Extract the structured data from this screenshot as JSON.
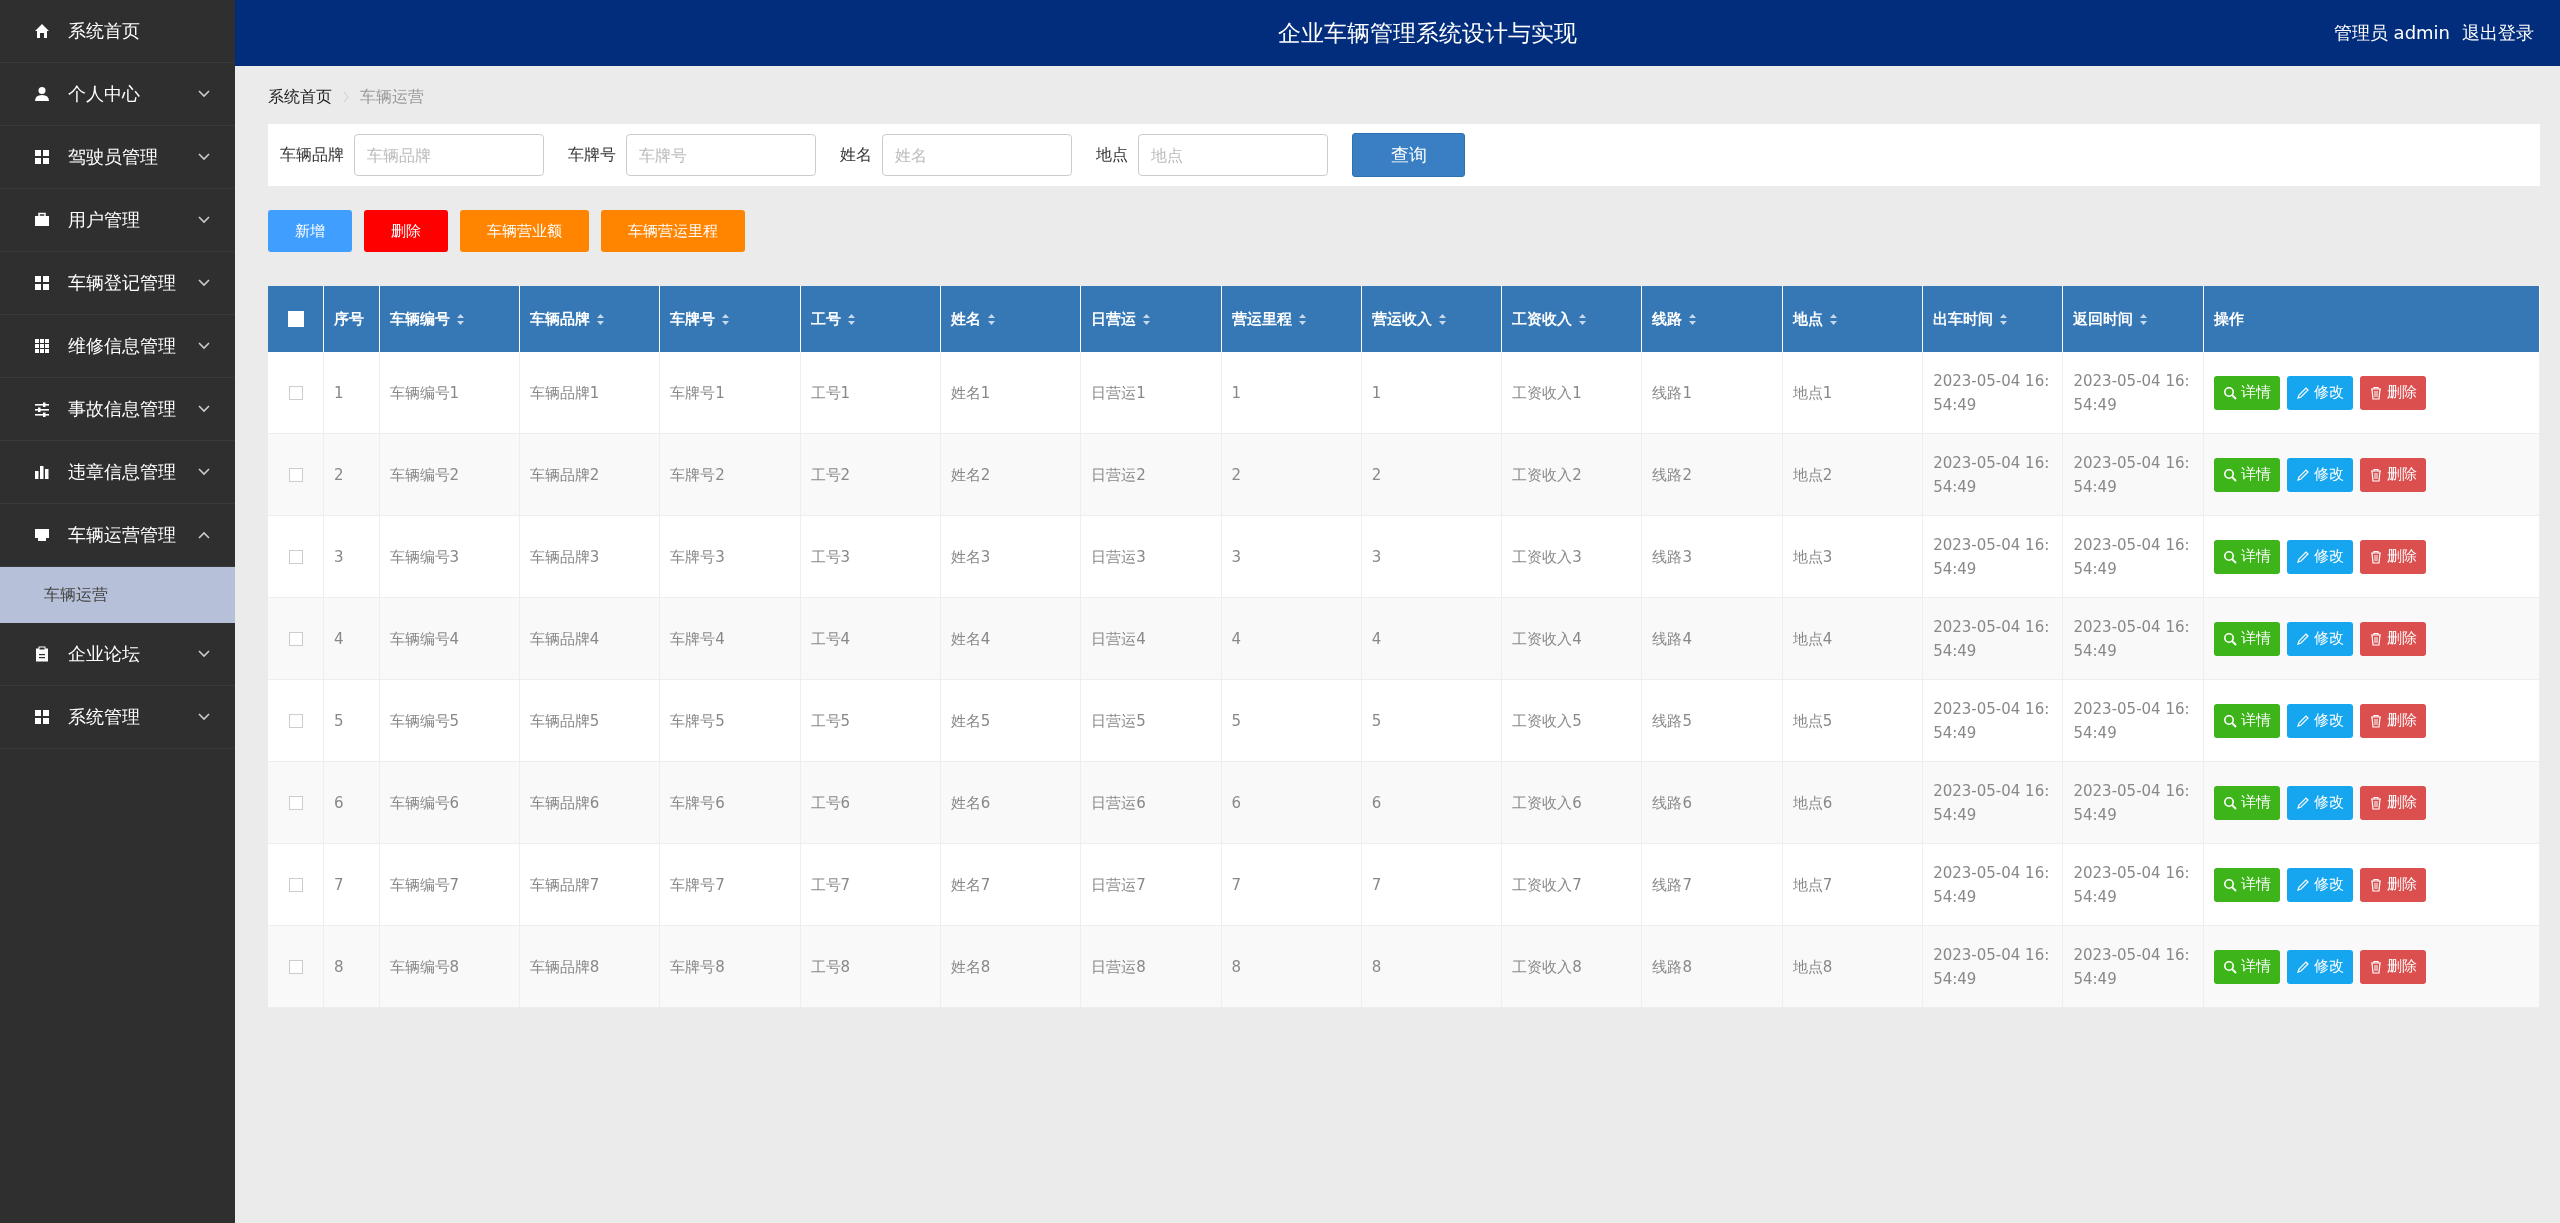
{
  "sidebar": {
    "items": [
      {
        "label": "系统首页",
        "kind": "home"
      },
      {
        "label": "个人中心",
        "kind": "user",
        "expanded": false,
        "has_caret": true
      },
      {
        "label": "驾驶员管理",
        "kind": "grid",
        "expanded": false,
        "has_caret": true
      },
      {
        "label": "用户管理",
        "kind": "briefcase",
        "expanded": false,
        "has_caret": true
      },
      {
        "label": "车辆登记管理",
        "kind": "grid",
        "expanded": false,
        "has_caret": true
      },
      {
        "label": "维修信息管理",
        "kind": "grid9",
        "expanded": false,
        "has_caret": true
      },
      {
        "label": "事故信息管理",
        "kind": "sliders",
        "expanded": false,
        "has_caret": true
      },
      {
        "label": "违章信息管理",
        "kind": "bars",
        "expanded": false,
        "has_caret": true
      },
      {
        "label": "车辆运营管理",
        "kind": "monitor",
        "expanded": true,
        "has_caret": true,
        "children": [
          {
            "label": "车辆运营",
            "selected": true
          }
        ]
      },
      {
        "label": "企业论坛",
        "kind": "clipboard",
        "expanded": false,
        "has_caret": true
      },
      {
        "label": "系统管理",
        "kind": "grid",
        "expanded": false,
        "has_caret": true
      }
    ]
  },
  "header": {
    "title": "企业车辆管理系统设计与实现",
    "user": "管理员 admin",
    "logout": "退出登录"
  },
  "breadcrumb": [
    "系统首页",
    "车辆运营"
  ],
  "search": {
    "fields": [
      {
        "label": "车辆品牌",
        "placeholder": "车辆品牌"
      },
      {
        "label": "车牌号",
        "placeholder": "车牌号"
      },
      {
        "label": "姓名",
        "placeholder": "姓名"
      },
      {
        "label": "地点",
        "placeholder": "地点"
      }
    ],
    "button": "查询"
  },
  "actions": [
    {
      "label": "新增",
      "kind": "primary"
    },
    {
      "label": "删除",
      "kind": "danger"
    },
    {
      "label": "车辆营业额",
      "kind": "warning"
    },
    {
      "label": "车辆营运里程",
      "kind": "warning"
    }
  ],
  "table": {
    "select_all": false,
    "columns": [
      {
        "label": "序号",
        "sortable": false
      },
      {
        "label": "车辆编号",
        "sortable": true
      },
      {
        "label": "车辆品牌",
        "sortable": true
      },
      {
        "label": "车牌号",
        "sortable": true
      },
      {
        "label": "工号",
        "sortable": true
      },
      {
        "label": "姓名",
        "sortable": true
      },
      {
        "label": "日营运",
        "sortable": true
      },
      {
        "label": "营运里程",
        "sortable": true
      },
      {
        "label": "营运收入",
        "sortable": true
      },
      {
        "label": "工资收入",
        "sortable": true
      },
      {
        "label": "线路",
        "sortable": true
      },
      {
        "label": "地点",
        "sortable": true
      },
      {
        "label": "出车时间",
        "sortable": true
      },
      {
        "label": "返回时间",
        "sortable": true
      },
      {
        "label": "操作",
        "sortable": false
      }
    ],
    "rows": [
      {
        "checked": false,
        "cells": [
          "1",
          "车辆编号1",
          "车辆品牌1",
          "车牌号1",
          "工号1",
          "姓名1",
          "日营运1",
          "1",
          "1",
          "工资收入1",
          "线路1",
          "地点1",
          "2023-05-04 16:54:49",
          "2023-05-04 16:54:49"
        ],
        "buttons": [
          {
            "label": "详情",
            "kind": "detail"
          },
          {
            "label": "修改",
            "kind": "edit"
          },
          {
            "label": "删除",
            "kind": "delete"
          }
        ]
      },
      {
        "checked": false,
        "cells": [
          "2",
          "车辆编号2",
          "车辆品牌2",
          "车牌号2",
          "工号2",
          "姓名2",
          "日营运2",
          "2",
          "2",
          "工资收入2",
          "线路2",
          "地点2",
          "2023-05-04 16:54:49",
          "2023-05-04 16:54:49"
        ],
        "buttons": [
          {
            "label": "详情",
            "kind": "detail"
          },
          {
            "label": "修改",
            "kind": "edit"
          },
          {
            "label": "删除",
            "kind": "delete"
          }
        ]
      },
      {
        "checked": false,
        "cells": [
          "3",
          "车辆编号3",
          "车辆品牌3",
          "车牌号3",
          "工号3",
          "姓名3",
          "日营运3",
          "3",
          "3",
          "工资收入3",
          "线路3",
          "地点3",
          "2023-05-04 16:54:49",
          "2023-05-04 16:54:49"
        ],
        "buttons": [
          {
            "label": "详情",
            "kind": "detail"
          },
          {
            "label": "修改",
            "kind": "edit"
          },
          {
            "label": "删除",
            "kind": "delete"
          }
        ]
      },
      {
        "checked": false,
        "cells": [
          "4",
          "车辆编号4",
          "车辆品牌4",
          "车牌号4",
          "工号4",
          "姓名4",
          "日营运4",
          "4",
          "4",
          "工资收入4",
          "线路4",
          "地点4",
          "2023-05-04 16:54:49",
          "2023-05-04 16:54:49"
        ],
        "buttons": [
          {
            "label": "详情",
            "kind": "detail"
          },
          {
            "label": "修改",
            "kind": "edit"
          },
          {
            "label": "删除",
            "kind": "delete"
          }
        ]
      },
      {
        "checked": false,
        "cells": [
          "5",
          "车辆编号5",
          "车辆品牌5",
          "车牌号5",
          "工号5",
          "姓名5",
          "日营运5",
          "5",
          "5",
          "工资收入5",
          "线路5",
          "地点5",
          "2023-05-04 16:54:49",
          "2023-05-04 16:54:49"
        ],
        "buttons": [
          {
            "label": "详情",
            "kind": "detail"
          },
          {
            "label": "修改",
            "kind": "edit"
          },
          {
            "label": "删除",
            "kind": "delete"
          }
        ]
      },
      {
        "checked": false,
        "cells": [
          "6",
          "车辆编号6",
          "车辆品牌6",
          "车牌号6",
          "工号6",
          "姓名6",
          "日营运6",
          "6",
          "6",
          "工资收入6",
          "线路6",
          "地点6",
          "2023-05-04 16:54:49",
          "2023-05-04 16:54:49"
        ],
        "buttons": [
          {
            "label": "详情",
            "kind": "detail"
          },
          {
            "label": "修改",
            "kind": "edit"
          },
          {
            "label": "删除",
            "kind": "delete"
          }
        ]
      },
      {
        "checked": false,
        "cells": [
          "7",
          "车辆编号7",
          "车辆品牌7",
          "车牌号7",
          "工号7",
          "姓名7",
          "日营运7",
          "7",
          "7",
          "工资收入7",
          "线路7",
          "地点7",
          "2023-05-04 16:54:49",
          "2023-05-04 16:54:49"
        ],
        "buttons": [
          {
            "label": "详情",
            "kind": "detail"
          },
          {
            "label": "修改",
            "kind": "edit"
          },
          {
            "label": "删除",
            "kind": "delete"
          }
        ]
      },
      {
        "checked": false,
        "cells": [
          "8",
          "车辆编号8",
          "车辆品牌8",
          "车牌号8",
          "工号8",
          "姓名8",
          "日营运8",
          "8",
          "8",
          "工资收入8",
          "线路8",
          "地点8",
          "2023-05-04 16:54:49",
          "2023-05-04 16:54:49"
        ],
        "buttons": [
          {
            "label": "详情",
            "kind": "detail"
          },
          {
            "label": "修改",
            "kind": "edit"
          },
          {
            "label": "删除",
            "kind": "delete"
          }
        ]
      }
    ]
  }
}
